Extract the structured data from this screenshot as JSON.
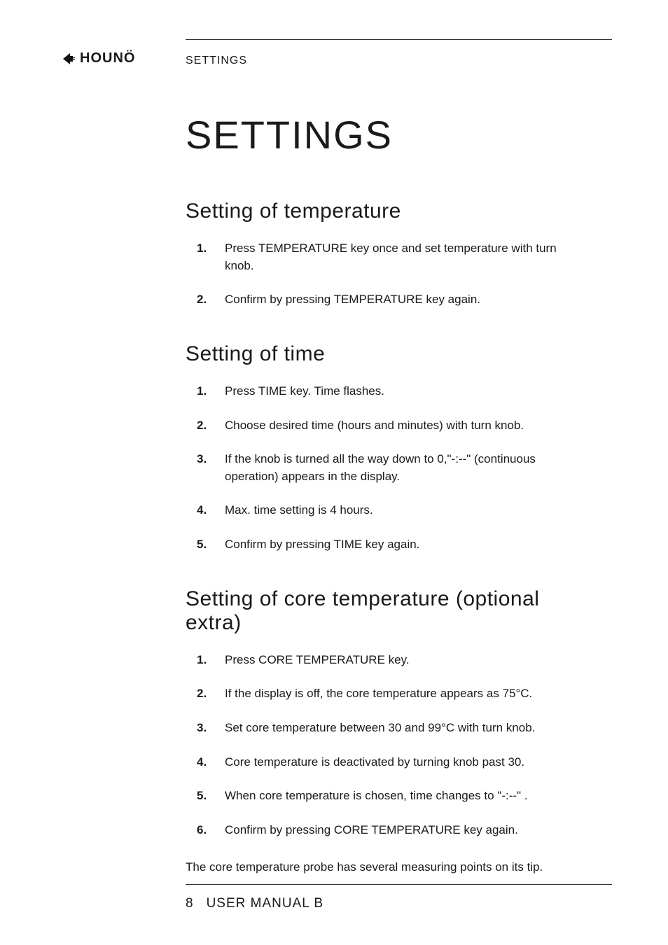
{
  "logo": {
    "text": "HOUNÖ"
  },
  "running_head": "SETTINGS",
  "title": "SETTINGS",
  "sections": [
    {
      "heading": "Setting of temperature",
      "steps": [
        "Press TEMPERATURE key once and set temperature with turn knob.",
        "Confirm by pressing TEMPERATURE key again."
      ]
    },
    {
      "heading": "Setting of time",
      "steps": [
        "Press TIME key. Time flashes.",
        "Choose desired time (hours and minutes) with turn knob.",
        "If the knob is turned all the way down to 0,\"-:--\" (continuous operation) appears in the display.",
        "Max. time setting is 4 hours.",
        "Confirm by pressing TIME key again."
      ]
    },
    {
      "heading": "Setting of core temperature (optional extra)",
      "steps": [
        "Press CORE TEMPERATURE key.",
        "If the display is off, the core temperature appears as 75°C.",
        "Set core temperature between 30 and 99°C with turn knob.",
        "Core temperature is deactivated by turning knob past 30.",
        "When core temperature is chosen, time changes to \"-:--\" .",
        "Confirm by pressing CORE TEMPERATURE key again."
      ],
      "trailing_text": "The core temperature probe has several measuring points on its tip."
    }
  ],
  "footer": {
    "page_number": "8",
    "doc_title": "USER MANUAL B"
  }
}
